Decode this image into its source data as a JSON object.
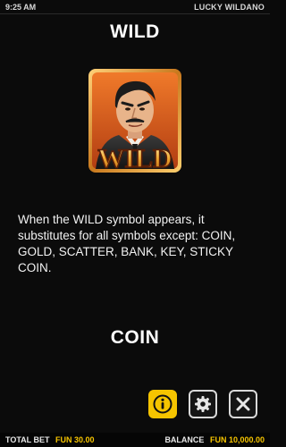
{
  "status_bar": {
    "time": "9:25 AM",
    "game_name": "LUCKY WILDANO"
  },
  "wild_section": {
    "title": "WILD",
    "symbol_text": "WILD",
    "description": "When the WILD symbol appears, it substitutes for all symbols except: COIN, GOLD, SCATTER, BANK, KEY, STICKY COIN."
  },
  "coin_section": {
    "title": "COIN"
  },
  "controls": {
    "info_icon": "info-icon",
    "settings_icon": "gear-icon",
    "close_icon": "close-icon"
  },
  "bottom_bar": {
    "total_bet_label": "TOTAL BET",
    "total_bet_value": "FUN 30.00",
    "balance_label": "BALANCE",
    "balance_value": "FUN 10,000.00"
  },
  "colors": {
    "accent": "#f5c400",
    "background": "#0b0b0b",
    "tile_orange": "#d9551e"
  }
}
